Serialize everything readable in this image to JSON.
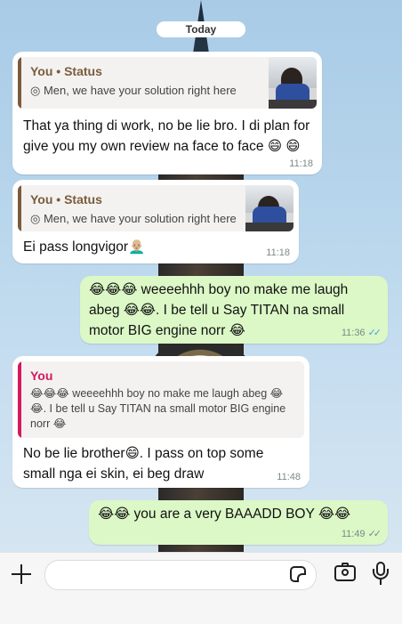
{
  "date_separator": "Today",
  "messages": [
    {
      "quote": {
        "title": "You • Status",
        "subtitle": "Men, we have your solution right here"
      },
      "text": "That ya thing di work, no be lie bro. I di plan for give you my own review na face to face 😄 😄",
      "time": "11:18"
    },
    {
      "quote": {
        "title": "You • Status",
        "subtitle": "Men, we have your solution right here"
      },
      "text": "Ei pass longvigor👨🏼‍🦲",
      "time": "11:18"
    },
    {
      "text": "😂😂😂 weeeehhh boy no make me laugh abeg 😂😂. I be tell u Say TITAN na small motor BIG engine norr 😂",
      "time": "11:36",
      "ticks": "✓✓"
    },
    {
      "quote": {
        "title": "You",
        "subtitle": "😂😂😂 weeeehhh boy no make me laugh abeg 😂😂. I be tell u Say TITAN na small motor BIG engine norr 😂"
      },
      "text": "No be lie brother😄. I pass on top some small nga ei skin, ei beg draw",
      "time": "11:48"
    },
    {
      "text": "😂😂 you are a very BAAADD BOY 😂😂",
      "time": "11:49",
      "ticks": "✓✓"
    }
  ],
  "icons": {
    "status_icon": "◎",
    "attach": "plus-icon",
    "sticker": "sticker-icon",
    "camera": "camera-icon",
    "mic": "microphone-icon"
  },
  "colors": {
    "outgoing_bubble": "#dbf8c6",
    "incoming_bubble": "#ffffff",
    "status_quote_accent": "#7b5b3d",
    "reply_quote_accent": "#d3195f",
    "read_ticks": "#4fa3e0"
  }
}
